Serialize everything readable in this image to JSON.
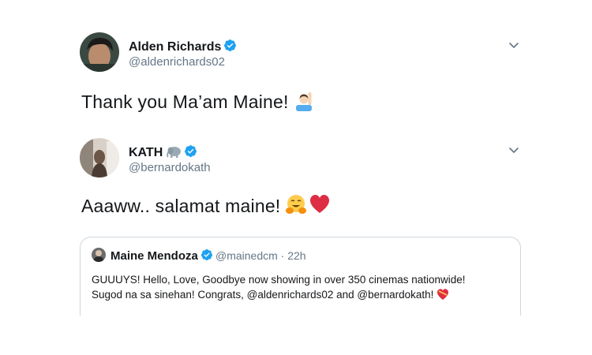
{
  "tweets": [
    {
      "display_name": "Alden Richards",
      "handle": "@aldenrichards02",
      "text": "Thank you Ma’am Maine!",
      "verified": true,
      "emoji": [
        "raising-hand-emoji"
      ]
    },
    {
      "display_name": "KATH",
      "handle": "@bernardokath",
      "text": "Aaaww.. salamat maine!",
      "verified": true,
      "emoji": [
        "hugging-face-emoji",
        "red-heart-emoji"
      ],
      "name_emoji": "elephant-emoji"
    }
  ],
  "quoted_tweet": {
    "display_name": "Maine Mendoza",
    "handle_and_time": "@mainedcm · 22h",
    "text_line1": "GUUUYS! Hello, Love, Goodbye now showing in over 350 cinemas nationwide!",
    "text_line2": "Sugod na sa sinehan! Congrats, @aldenrichards02 and @bernardokath!",
    "emoji": [
      "heart-with-ribbon-emoji"
    ],
    "verified": true
  },
  "colors": {
    "verified_blue": "#1da1f2",
    "secondary_text": "#657786",
    "primary_text": "#14171a",
    "border": "#ccd6dd",
    "heart_red": "#dd2e44"
  },
  "icons": [
    "verified-badge-icon",
    "chevron-down-icon"
  ]
}
